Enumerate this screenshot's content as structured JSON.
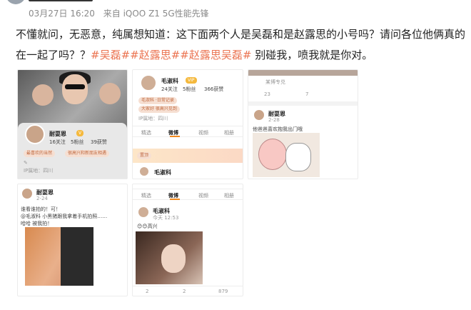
{
  "meta": {
    "date": "03月27日 16:20",
    "source": "来自 iQOO Z1 5G性能先锋"
  },
  "post": {
    "text_part1": "不懂就问，无恶意，纯属想知道：这下面两个人是吴磊和是赵露思的小号吗？请问各位他俩真的在一起了吗？？",
    "tag1": "#吴磊#",
    "tag2": "#赵露思#",
    "tag3": "#赵露思吴磊#",
    "text_part2": " 别碰我，喷我就是你对。"
  },
  "cards": {
    "c1": {
      "name": "耐耍恩",
      "stats": [
        "16关注",
        "5粉丝",
        "39获赞"
      ],
      "tag1": "最喜欢的当然",
      "tag2": "很高兴和新朋友相遇",
      "loc": "IP属地：四川"
    },
    "c2": {
      "name": "毛淑科",
      "vip": "VIP",
      "stats": [
        "24关注",
        "5粉丝",
        "366获赞"
      ],
      "tag1": "毛淑科 ·日常记录",
      "tag2": "大家好 很高兴见到",
      "loc": "IP属地：四川",
      "tabs": [
        "精选",
        "微博",
        "视频",
        "相册"
      ],
      "banner": "置顶",
      "poster": "毛淑科"
    },
    "c3": {
      "top": "某博专兑",
      "comment_count": "23",
      "like_count": "7",
      "name": "耐耍恩",
      "time": "2-28",
      "caption": "他爸爸喜欢抱我出门哦"
    },
    "c4": {
      "name": "耐耍恩",
      "time": "2-24",
      "line1": "谁看谁拍的！可！",
      "line2": "@毛淑科 小黑猪跟我拿着手机拍照……",
      "line3": "哈哈 被我拍！"
    },
    "c5": {
      "tabs": [
        "精选",
        "微博",
        "视频",
        "相册"
      ],
      "name": "毛淑科",
      "time": "今天 12:53",
      "caption": "😊😊高兴",
      "comments": "2",
      "likes": "2",
      "reposts": "879"
    }
  },
  "colors": {
    "accent": "#eb7350",
    "tab_underline": "#f28a1e"
  }
}
